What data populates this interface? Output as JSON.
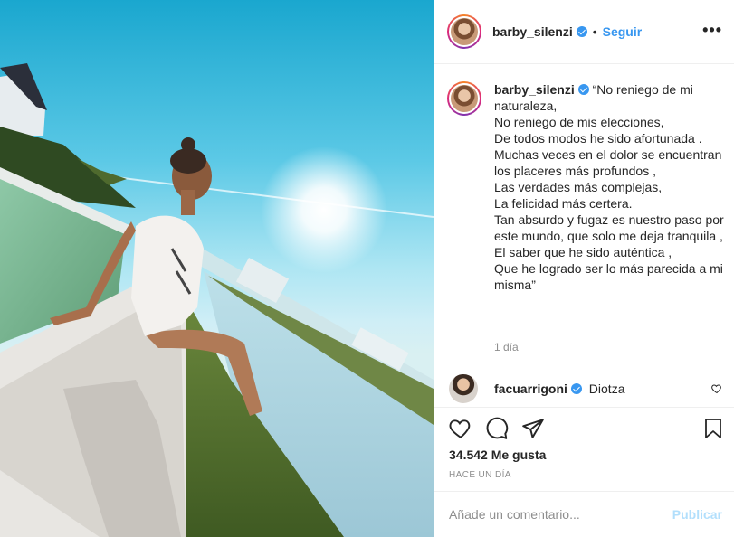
{
  "post": {
    "username": "barby_silenzi",
    "separator": "•",
    "follow_label": "Seguir",
    "more_icon": "more-horizontal-icon"
  },
  "caption": {
    "username": "barby_silenzi",
    "text": "“No reniego de mi naturaleza,\nNo reniego de mis elecciones,\nDe todos modos he sido afortunada .\nMuchas veces en el dolor se encuentran los placeres más profundos ,\nLas verdades más complejas,\nLa felicidad más certera.\nTan absurdo y fugaz es nuestro paso por este mundo, que solo me deja tranquila ,\nEl saber que he sido auténtica ,\nQue he logrado ser lo más parecida a mi misma”",
    "time_ago": "1 día"
  },
  "comments": [
    {
      "username": "facuarrigoni",
      "text": "Diotza"
    }
  ],
  "actions": {
    "icons": [
      "heart-icon",
      "comment-icon",
      "share-icon",
      "bookmark-icon"
    ]
  },
  "likes_label": "34.542 Me gusta",
  "posted_label": "HACE UN DÍA",
  "add_comment": {
    "placeholder": "Añade un comentario...",
    "publish_label": "Publicar"
  },
  "colors": {
    "accent": "#3897f0",
    "publish_disabled": "#b2dffc",
    "muted": "#8e8e8e"
  }
}
